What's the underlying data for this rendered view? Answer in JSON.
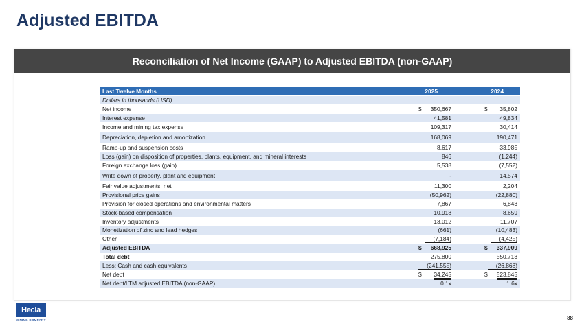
{
  "title": "Adjusted EBITDA",
  "panel_title": "Reconciliation of Net Income (GAAP) to Adjusted EBITDA (non-GAAP)",
  "table": {
    "header": {
      "label": "Last Twelve Months",
      "col1": "2025",
      "col2": "2024"
    },
    "subheader": "Dollars in thousands (USD)",
    "rows": [
      {
        "label": "Net income",
        "v1": "350,667",
        "v2": "35,802",
        "cur": "$",
        "style": "plain"
      },
      {
        "label": "Interest expense",
        "v1": "41,581",
        "v2": "49,834",
        "style": "alt"
      },
      {
        "label": "Income and mining tax expense",
        "v1": "109,317",
        "v2": "30,414",
        "style": "plain"
      },
      {
        "label": "Depreciation, depletion and amortization",
        "v1": "168,069",
        "v2": "190,471",
        "style": "alt tall"
      },
      {
        "label": "Ramp-up and suspension costs",
        "v1": "8,617",
        "v2": "33,985",
        "style": "plain"
      },
      {
        "label": "Loss (gain) on disposition of properties, plants, equipment, and mineral interests",
        "v1": "846",
        "v2": "(1,244)",
        "style": "alt"
      },
      {
        "label": "Foreign exchange loss (gain)",
        "v1": "5,538",
        "v2": "(7,552)",
        "style": "plain"
      },
      {
        "label": "Write down of property, plant and equipment",
        "v1": "-",
        "v2": "14,574",
        "style": "alt tall"
      },
      {
        "label": "Fair value adjustments, net",
        "v1": "11,300",
        "v2": "2,204",
        "style": "plain"
      },
      {
        "label": "Provisional price gains",
        "v1": "(50,962)",
        "v2": "(22,880)",
        "style": "alt"
      },
      {
        "label": "Provision for closed operations and environmental matters",
        "v1": "7,867",
        "v2": "6,843",
        "style": "plain"
      },
      {
        "label": "Stock-based compensation",
        "v1": "10,918",
        "v2": "8,659",
        "style": "alt"
      },
      {
        "label": "Inventory adjustments",
        "v1": "13,012",
        "v2": "11,707",
        "style": "plain"
      },
      {
        "label": "Monetization of zinc and lead hedges",
        "v1": "(661)",
        "v2": "(10,483)",
        "style": "alt"
      },
      {
        "label": "Other",
        "v1": "(7,184)",
        "v2": "(4,425)",
        "style": "plain",
        "underline": true
      },
      {
        "label": "Adjusted EBITDA",
        "v1": "668,925",
        "v2": "337,909",
        "cur": "$",
        "style": "alt bold"
      },
      {
        "label": "Total debt",
        "v1": "275,800",
        "v2": "550,713",
        "style": "plain boldlabel"
      },
      {
        "label": "Less: Cash and cash equivalents",
        "v1": "(241,555)",
        "v2": "(26,868)",
        "style": "alt",
        "underline": true
      },
      {
        "label": "Net debt",
        "v1": "34,245",
        "v2": "523,845",
        "cur": "$",
        "style": "plain",
        "double": true
      },
      {
        "label": "Net debt/LTM adjusted EBITDA (non-GAAP)",
        "v1": "0.1x",
        "v2": "1.6x",
        "style": "alt"
      }
    ]
  },
  "logo": {
    "name": "Hecla",
    "sub": "MINING COMPANY",
    "color": "#1f4e9a"
  },
  "page_number": "88",
  "colors": {
    "title": "#1f3864",
    "header_bar": "#454545",
    "table_head": "#2f6db5",
    "alt_row": "#dde6f4"
  }
}
